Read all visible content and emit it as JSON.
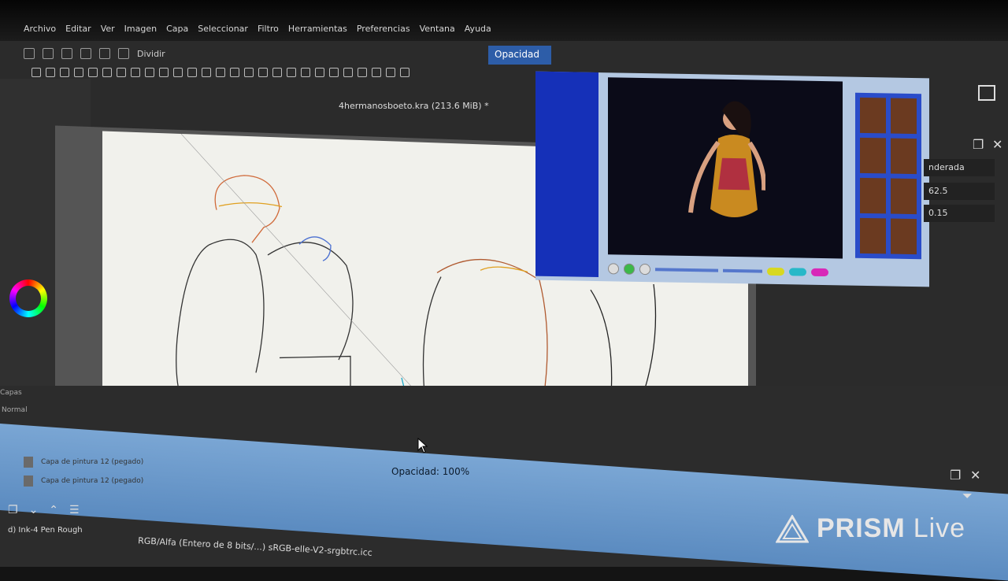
{
  "menu": {
    "items": [
      "Archivo",
      "Editar",
      "Ver",
      "Imagen",
      "Capa",
      "Seleccionar",
      "Filtro",
      "Herramientas",
      "Preferencias",
      "Ventana",
      "Ayuda"
    ]
  },
  "toolbar": {
    "wrap_label": "Dividir",
    "opacity_label": "Opacidad"
  },
  "document": {
    "title": "4hermanosboeto.kra (213.6 MiB) *"
  },
  "right_panel": {
    "blend_mode": "nderada",
    "size_value": "62.5",
    "flow_value": "0.15"
  },
  "layers": {
    "panel_title": "Capas",
    "blend_mode": "Normal",
    "opacity_text": "Opacidad:  100%",
    "items": [
      {
        "name": "Capa de pintura 12 (pegado)"
      },
      {
        "name": "Capa de pintura 12 (pegado)"
      }
    ]
  },
  "brush": {
    "name": "d) Ink-4 Pen Rough"
  },
  "status": {
    "color_space": "RGB/Alfa (Entero de 8 bits/...) sRGB-elle-V2-srgbtrc.icc"
  },
  "watermark": {
    "brand": "PRISM",
    "suffix": "Live"
  },
  "colors": {
    "accent": "#2d5da8",
    "opacity_bar": "#6e9bcf",
    "video_frame": "#1530b8"
  }
}
